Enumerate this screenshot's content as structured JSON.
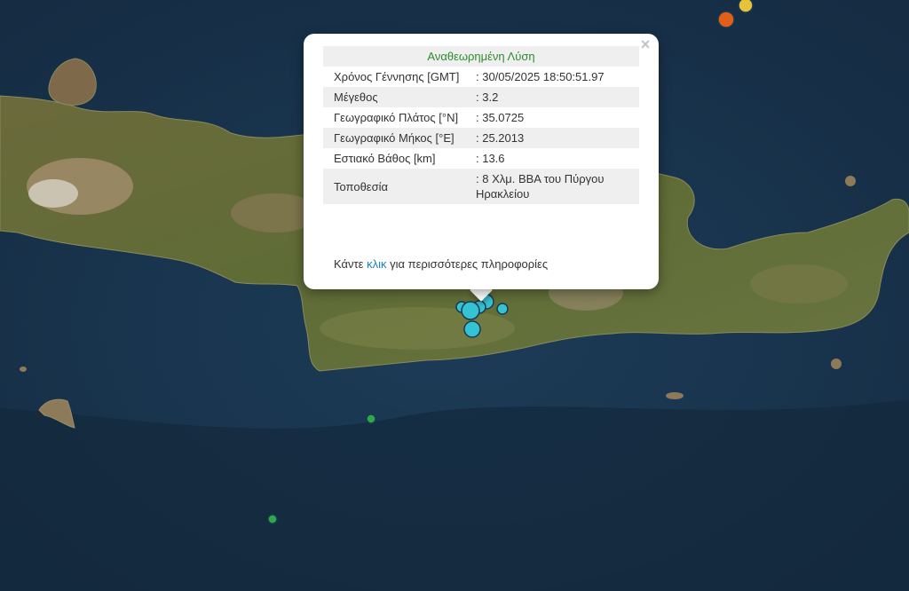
{
  "map": {
    "colors": {
      "sea_deep": "#13283e",
      "sea": "#1c3a55",
      "land": "#6f7a3f",
      "land_dark": "#4d5a2c",
      "mountain": "#a48f6c",
      "marker_recent": "#35c3d4",
      "marker_green": "#2ea84a",
      "marker_orange": "#e0601a",
      "marker_yellow": "#e8c23a"
    },
    "marker_icon": "circle-marker-icon"
  },
  "popup": {
    "title": "Αναθεωρημένη Λύση",
    "rows": [
      {
        "label": "Χρόνος Γέννησης [GMT]",
        "value": ": 30/05/2025 18:50:51.97"
      },
      {
        "label": "Μέγεθος",
        "value": ": 3.2"
      },
      {
        "label": "Γεωγραφικό Πλάτος [°N]",
        "value": ": 35.0725"
      },
      {
        "label": "Γεωγραφικό Μήκος [°E]",
        "value": ": 25.2013"
      },
      {
        "label": "Εστιακό Βάθος [km]",
        "value": ": 13.6"
      },
      {
        "label": "Τοποθεσία",
        "value": ": 8 Χλμ. ΒΒΑ του Πύργου Ηρακλείου"
      }
    ],
    "more_prefix": "Κάντε",
    "more_link": "κλικ",
    "more_suffix": "για περισσότερες πληροφορίες",
    "close_symbol": "×",
    "close_icon": "close-icon"
  }
}
